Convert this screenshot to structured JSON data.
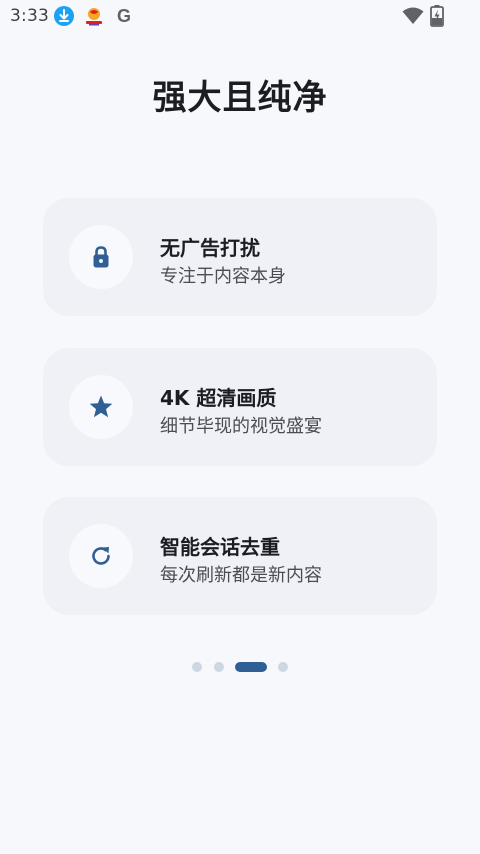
{
  "status_bar": {
    "time": "3:33",
    "icons": [
      "download-icon",
      "app-icon",
      "google-icon",
      "wifi-icon",
      "battery-charging-icon"
    ],
    "google_letter": "G"
  },
  "title": "强大且纯净",
  "features": [
    {
      "icon": "lock-icon",
      "title": "无广告打扰",
      "description": "专注于内容本身"
    },
    {
      "icon": "star-icon",
      "title": "4K 超清画质",
      "description": "细节毕现的视觉盛宴"
    },
    {
      "icon": "refresh-icon",
      "title": "智能会话去重",
      "description": "每次刷新都是新内容"
    }
  ],
  "pager": {
    "page_count": 4,
    "active_index": 2
  },
  "colors": {
    "accent": "#2f5f94",
    "card_background": "#eff1f6",
    "page_background": "#f7f8fc",
    "dot_inactive": "#cdd6e3"
  }
}
